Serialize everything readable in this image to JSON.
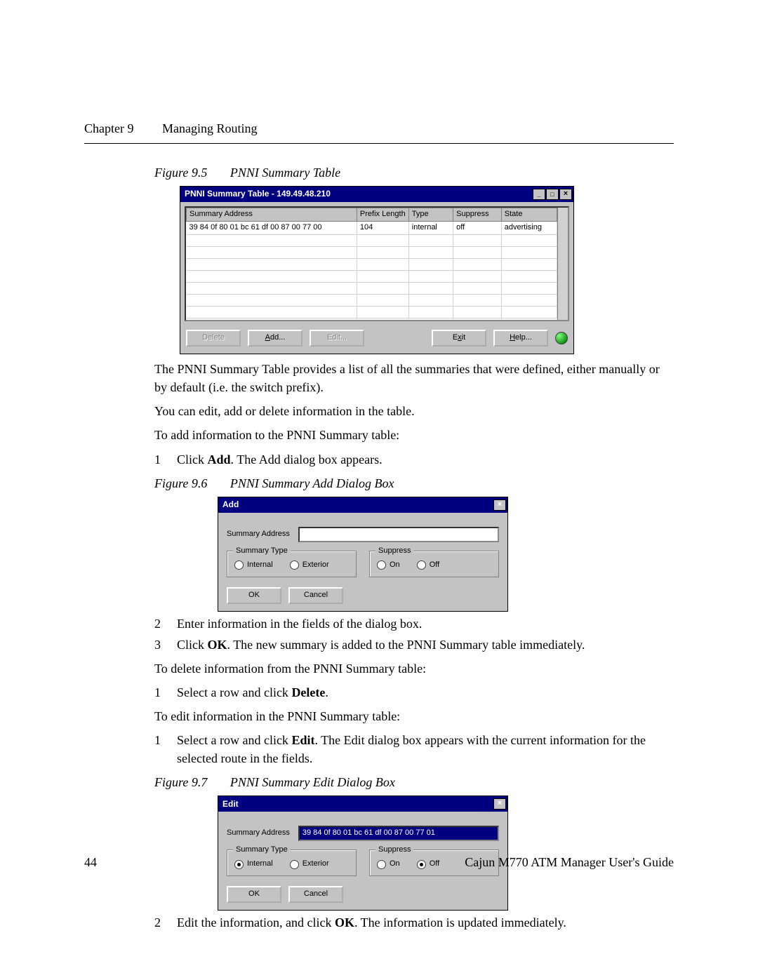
{
  "header": {
    "chapter": "Chapter 9",
    "title": "Managing Routing"
  },
  "fig95": {
    "label": "Figure 9.5",
    "caption": "PNNI Summary Table",
    "window_title": "PNNI Summary Table - 149.49.48.210",
    "columns": [
      "Summary Address",
      "Prefix Length",
      "Type",
      "Suppress",
      "State"
    ],
    "rows": [
      {
        "summary_address": "39 84 0f 80 01 bc 61 df 00 87 00 77 00",
        "prefix_length": "104",
        "type": "internal",
        "suppress": "off",
        "state": "advertising"
      }
    ],
    "buttons": {
      "delete": "Delete",
      "add": "Add...",
      "edit": "Edit...",
      "exit": "Exit",
      "help": "Help..."
    }
  },
  "para1": "The PNNI Summary Table provides a list of all the summaries that were defined, either manually or by default (i.e. the switch prefix).",
  "para2": "You can edit, add or delete information in the table.",
  "para3": "To add information to the PNNI Summary table:",
  "step1a_n": "1",
  "step1a_pre": "Click ",
  "step1a_bold": "Add",
  "step1a_post": ". The Add dialog box appears.",
  "fig96": {
    "label": "Figure 9.6",
    "caption": "PNNI Summary Add Dialog Box",
    "window_title": "Add",
    "field_label": "Summary Address",
    "field_value": "",
    "group_type_label": "Summary Type",
    "radio_internal": "Internal",
    "radio_exterior": "Exterior",
    "group_supp_label": "Suppress",
    "radio_on": "On",
    "radio_off": "Off",
    "btn_ok": "OK",
    "btn_cancel": "Cancel"
  },
  "step2_n": "2",
  "step2_t": "Enter information in the fields of the dialog box.",
  "step3_n": "3",
  "step3_pre": "Click ",
  "step3_bold": "OK",
  "step3_post": ". The new summary is added to the PNNI Summary table immediately.",
  "para4": "To delete information from the PNNI Summary table:",
  "stepD1_n": "1",
  "stepD1_pre": "Select a row and click ",
  "stepD1_bold": "Delete",
  "stepD1_post": ".",
  "para5": "To edit information in the PNNI Summary table:",
  "stepE1_n": "1",
  "stepE1_pre": "Select a row and click ",
  "stepE1_bold": "Edit",
  "stepE1_post": ". The Edit dialog box appears with the current information for the selected route in the fields.",
  "fig97": {
    "label": "Figure 9.7",
    "caption": "PNNI Summary Edit Dialog Box",
    "window_title": "Edit",
    "field_label": "Summary Address",
    "field_value": "39 84 0f 80 01 bc 61 df 00 87 00 77 01",
    "group_type_label": "Summary Type",
    "radio_internal": "Internal",
    "radio_exterior": "Exterior",
    "group_supp_label": "Suppress",
    "radio_on": "On",
    "radio_off": "Off",
    "btn_ok": "OK",
    "btn_cancel": "Cancel"
  },
  "stepE2_n": "2",
  "stepE2_pre": "Edit the information, and click ",
  "stepE2_bold": "OK",
  "stepE2_post": ". The information is updated immediately.",
  "footer": {
    "page": "44",
    "book": "Cajun M770 ATM Manager User's Guide"
  }
}
